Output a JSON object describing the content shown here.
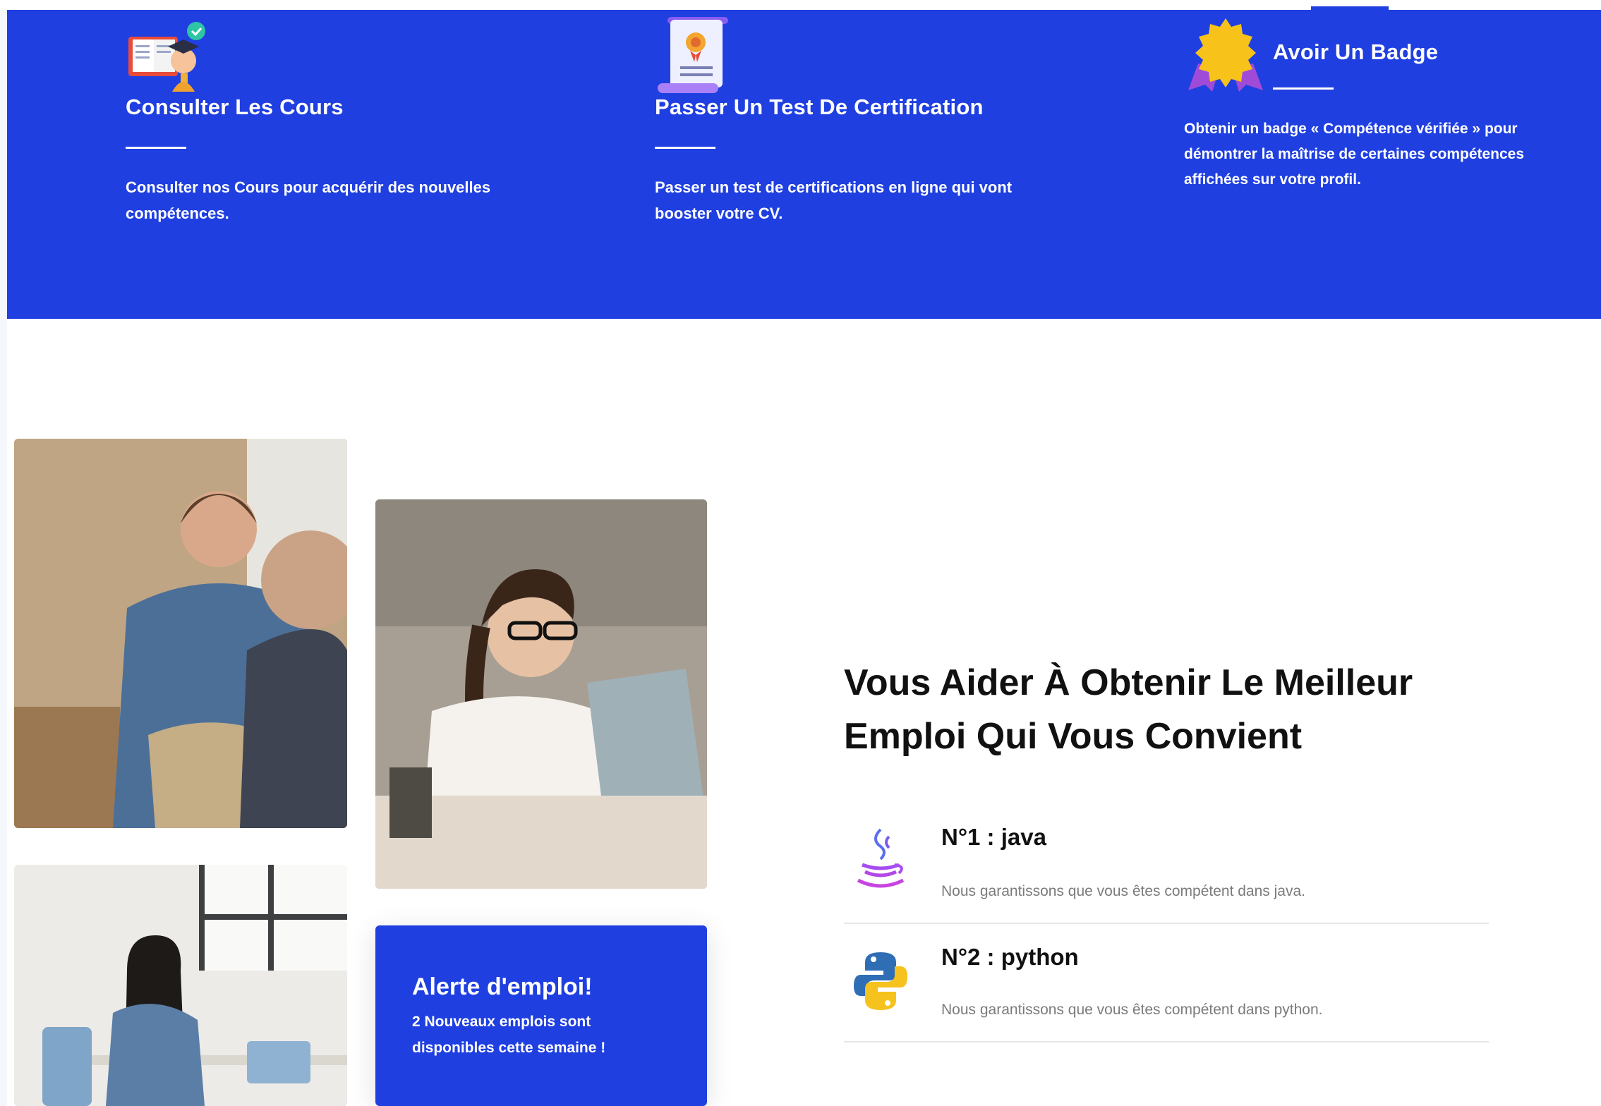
{
  "features": [
    {
      "title": "Consulter Les Cours",
      "text": "Consulter nos Cours pour acquérir des nouvelles compétences.",
      "icon": "courses-icon"
    },
    {
      "title": "Passer Un Test De Certification",
      "text": "Passer un test de certifications en ligne qui vont booster votre CV.",
      "icon": "certificate-icon"
    },
    {
      "title": "Avoir Un Badge",
      "text": "Obtenir un badge « Compétence vérifiée » pour démontrer la maîtrise de certaines compétences affichées sur votre profil.",
      "icon": "badge-icon"
    }
  ],
  "alert": {
    "title": "Alerte d'emploi!",
    "text": "2 Nouveaux emplois sont disponibles cette semaine !"
  },
  "section": {
    "title": "Vous Aider À Obtenir Le Meilleur Emploi Qui Vous Convient"
  },
  "skills": [
    {
      "title": "N°1 : java",
      "text": "Nous garantissons que vous êtes compétent dans java.",
      "icon": "java-icon"
    },
    {
      "title": "N°2 : python",
      "text": "Nous garantissons que vous êtes compétent dans python.",
      "icon": "python-icon"
    }
  ],
  "colors": {
    "primary": "#1f3fe0",
    "heading": "#111111",
    "muted": "#7b7b7b"
  }
}
